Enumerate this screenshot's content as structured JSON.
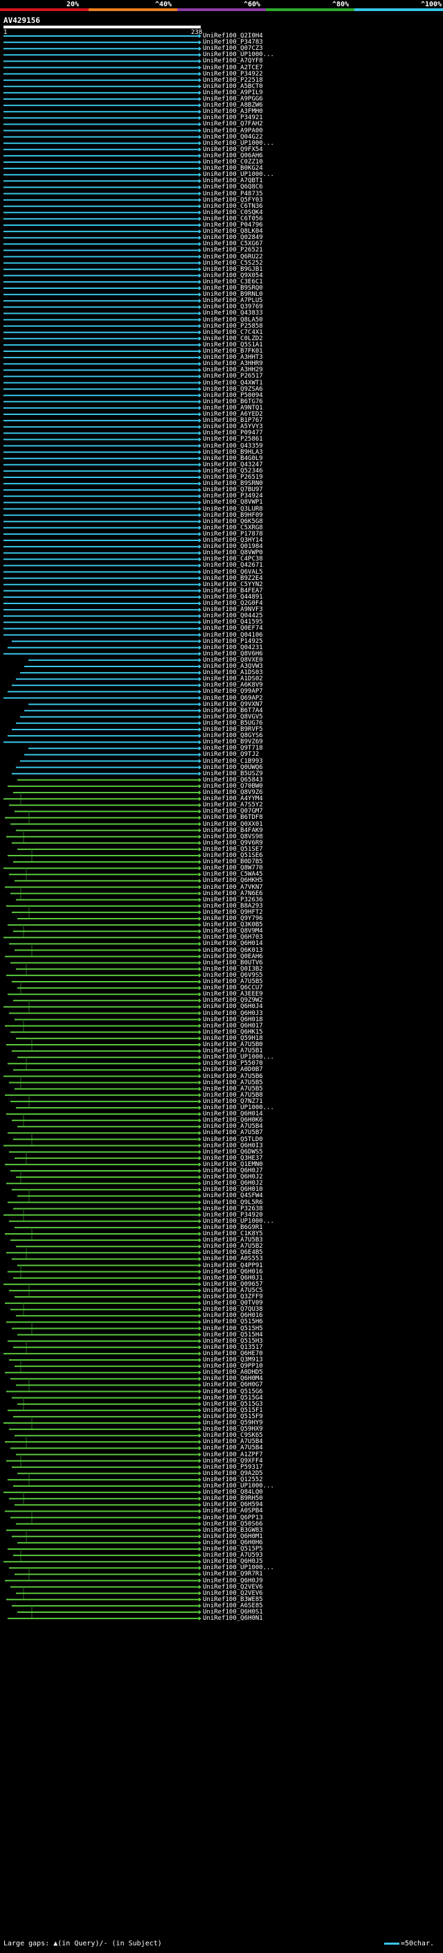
{
  "scale": {
    "labels": [
      "20%",
      "^40%",
      "^60%",
      "^80%",
      "^100%"
    ],
    "colors": [
      "#d5141d",
      "#f07f1e",
      "#8e3ea6",
      "#2eaa2e",
      "#39c5e8"
    ]
  },
  "query": {
    "id": "AV429156",
    "start": "1",
    "end": "238"
  },
  "hit_colors": {
    "high": "#39c5e8",
    "low": "#5ac83c"
  },
  "hits": [
    "UniRef100_Q2I0H4",
    "UniRef100_P34783",
    "UniRef100_Q07CZ3",
    "UniRef100_UP1000...",
    "UniRef100_A7QYF8",
    "UniRef100_A2TCE7",
    "UniRef100_P34922",
    "UniRef100_P22518",
    "UniRef100_A5BCT0",
    "UniRef100_A9PIL9",
    "UniRef100_A9PGG6",
    "UniRef100_A8BZW6",
    "UniRef100_A3FMH0",
    "UniRef100_P34921",
    "UniRef100_Q7FAH2",
    "UniRef100_A9PA00",
    "UniRef100_Q04G22",
    "UniRef100_UP1000...",
    "UniRef100_Q9FX54",
    "UniRef100_Q06AH6",
    "UniRef100_C0ZZ10",
    "UniRef100_B0KG24",
    "UniRef100_UP1000...",
    "UniRef100_A7QBT1",
    "UniRef100_Q6Q8C6",
    "UniRef100_P48735",
    "UniRef100_Q5FY03",
    "UniRef100_C6TN36",
    "UniRef100_C0SQK4",
    "UniRef100_C6T056",
    "UniRef100_P04796",
    "UniRef100_Q8LK04",
    "UniRef100_Q02849",
    "UniRef100_C5XG67",
    "UniRef100_P26521",
    "UniRef100_Q6RU22",
    "UniRef100_C5S252",
    "UniRef100_B9GJB1",
    "UniRef100_Q9X054",
    "UniRef100_C3E6C1",
    "UniRef100_B9SRQ0",
    "UniRef100_B9RNL0",
    "UniRef100_A7PLU5",
    "UniRef100_Q39769",
    "UniRef100_Q43833",
    "UniRef100_Q8LA50",
    "UniRef100_P25858",
    "UniRef100_C7C4X1",
    "UniRef100_C0LZD2",
    "UniRef100_Q5S1A1",
    "UniRef100_B7FK01",
    "UniRef100_A3HHT3",
    "UniRef100_A3HHR9",
    "UniRef100_A3HH29",
    "UniRef100_P26517",
    "UniRef100_Q4XWT1",
    "UniRef100_Q9ZSA6",
    "UniRef100_P50094",
    "UniRef100_B6TG76",
    "UniRef100_A9NTQ1",
    "UniRef100_A6YED2",
    "UniRef100_B1P767",
    "UniRef100_A5YVY3",
    "UniRef100_P09477",
    "UniRef100_P25861",
    "UniRef100_Q43359",
    "UniRef100_B9HLA3",
    "UniRef100_B4G0L9",
    "UniRef100_Q43247",
    "UniRef100_Q52346",
    "UniRef100_P26519",
    "UniRef100_B9SRN0",
    "UniRef100_Q7BU97",
    "UniRef100_P34924",
    "UniRef100_Q8VWP1",
    "UniRef100_Q3LUR8",
    "UniRef100_B9HF09",
    "UniRef100_Q6K5G8",
    "UniRef100_C5XRG8",
    "UniRef100_P17878",
    "UniRef100_Q3HY14",
    "UniRef100_Q01984",
    "UniRef100_Q8VWP0",
    "UniRef100_C4PC38",
    "UniRef100_Q42671",
    "UniRef100_Q6VAL5",
    "UniRef100_B9Z2E4",
    "UniRef100_C5YYN2",
    "UniRef100_B4FEA7",
    "UniRef100_Q44891",
    "UniRef100_Q2G0F4",
    "UniRef100_A9NVF3",
    "UniRef100_Q04425",
    "UniRef100_Q41595",
    "UniRef100_Q0EF74",
    "UniRef100_Q04106",
    "UniRef100_P14925",
    "UniRef100_Q04231",
    "UniRef100_Q8V6H6",
    "UniRef100_Q8VXE0",
    "UniRef100_A3QVW3",
    "UniRef100_A1DS03",
    "UniRef100_A1DS02",
    "UniRef100_A6K8V9",
    "UniRef100_Q99AP7",
    "UniRef100_Q69AP2",
    "UniRef100_Q9VXN7",
    "UniRef100_B6T7A4",
    "UniRef100_Q8VGV5",
    "UniRef100_B5UG76",
    "UniRef100_B9RVF5",
    "UniRef100_Q8GYS6",
    "UniRef100_B9VZ69",
    "UniRef100_Q9T718",
    "UniRef100_Q9TJ2",
    "UniRef100_C1B993",
    "UniRef100_Q0UWQ6",
    "UniRef100_B5USZ9",
    "UniRef100_Q65843",
    "UniRef100_Q70BW0",
    "UniRef100_Q8V9Z6",
    "UniRef100_A4YYM4",
    "UniRef100_A7S5Y2",
    "UniRef100_Q07GM7",
    "UniRef100_B6TDF8",
    "UniRef100_Q0XX01",
    "UniRef100_B4FAK9",
    "UniRef100_Q8VS98",
    "UniRef100_Q9V6R9",
    "UniRef100_Q51SE7",
    "UniRef100_Q51SE6",
    "UniRef100_B0D7B5",
    "UniRef100_Q8W770",
    "UniRef100_C5WA45",
    "UniRef100_Q6HKH5",
    "UniRef100_A7VKN7",
    "UniRef100_A7N6E6",
    "UniRef100_P32636",
    "UniRef100_B8A293",
    "UniRef100_Q9HFT2",
    "UniRef100_Q9Y796",
    "UniRef100_Q3K0B5",
    "UniRef100_Q8V9M4",
    "UniRef100_Q6H703",
    "UniRef100_Q6H014",
    "UniRef100_Q6K013",
    "UniRef100_Q0EAH6",
    "UniRef100_B0UTV6",
    "UniRef100_Q0I3B2",
    "UniRef100_Q6V9S5",
    "UniRef100_A7U5B5",
    "UniRef100_Q6CCU7",
    "UniRef100_A3EEE9",
    "UniRef100_Q9Z9W2",
    "UniRef100_Q6H0J4",
    "UniRef100_Q6H0J3",
    "UniRef100_Q6H018",
    "UniRef100_Q6H017",
    "UniRef100_Q6HK15",
    "UniRef100_Q59H18",
    "UniRef100_A7U5B0",
    "UniRef100_A7U5B1",
    "UniRef100_UP1000...",
    "UniRef100_P55070",
    "UniRef100_A0D0B7",
    "UniRef100_A7U5B6",
    "UniRef100_A7U5B5",
    "UniRef100_A7U5B5",
    "UniRef100_A7U5B8",
    "UniRef100_Q7NZ71",
    "UniRef100_UP1000...",
    "UniRef100_Q6H014",
    "UniRef100_Q6H0K6",
    "UniRef100_A7U5B4",
    "UniRef100_A7U5B7",
    "UniRef100_Q5TLD0",
    "UniRef100_Q6H0I3",
    "UniRef100_Q6DWS5",
    "UniRef100_Q3HE37",
    "UniRef100_Q1EMN0",
    "UniRef100_Q6H0J7",
    "UniRef100_Q6H0J2",
    "UniRef100_Q6H0J2",
    "UniRef100_Q6H010",
    "UniRef100_Q4SFW4",
    "UniRef100_Q9L5R6",
    "UniRef100_P32638",
    "UniRef100_P34920",
    "UniRef100_UP1000...",
    "UniRef100_B6G9R1",
    "UniRef100_C1K8Y5",
    "UniRef100_A7U5B3",
    "UniRef100_A7U5B2",
    "UniRef100_Q6E4B5",
    "UniRef100_A0S553",
    "UniRef100_Q4PP91",
    "UniRef100_Q6H016",
    "UniRef100_Q6H0J1",
    "UniRef100_Q09657",
    "UniRef100_A7U5C5",
    "UniRef100_Q3ZFF9",
    "UniRef100_Q0TV09",
    "UniRef100_Q7QU38",
    "UniRef100_Q6H016",
    "UniRef100_Q515H6",
    "UniRef100_Q515H5",
    "UniRef100_Q515H4",
    "UniRef100_Q515H3",
    "UniRef100_Q13517",
    "UniRef100_Q6HE70",
    "UniRef100_Q3M913",
    "UniRef100_Q9PP10",
    "UniRef100_A0DHD5",
    "UniRef100_Q6H0M4",
    "UniRef100_Q6H0G7",
    "UniRef100_Q515G6",
    "UniRef100_Q515G4",
    "UniRef100_Q515G3",
    "UniRef100_Q515F1",
    "UniRef100_Q515F9",
    "UniRef100_Q59HY9",
    "UniRef100_Q59HX9",
    "UniRef100_C9SK65",
    "UniRef100_A7U5B4",
    "UniRef100_A7U5B4",
    "UniRef100_A1ZPF7",
    "UniRef100_Q9XFF4",
    "UniRef100_P59317",
    "UniRef100_Q9A2D5",
    "UniRef100_Q12552",
    "UniRef100_UP1000...",
    "UniRef100_Q84LQ0",
    "UniRef100_B9RH50",
    "UniRef100_Q6H594",
    "UniRef100_A0SPB4",
    "UniRef100_Q6PP13",
    "UniRef100_Q50S66",
    "UniRef100_B3GW83",
    "UniRef100_Q6H0M1",
    "UniRef100_Q6H0H6",
    "UniRef100_Q515P5",
    "UniRef100_A7U593",
    "UniRef100_Q6H0J5",
    "UniRef100_UP1000...",
    "UniRef100_Q9R7R1",
    "UniRef100_Q6H0J9",
    "UniRef100_Q2VEV6",
    "UniRef100_Q2VEV6",
    "UniRef100_B3WE85",
    "UniRef100_A6SE85",
    "UniRef100_Q6H0S1",
    "UniRef100_Q6H0N1"
  ],
  "legend": {
    "left": "Large gaps: ▲(in Query)/- (in Subject)",
    "right": "=50char."
  }
}
